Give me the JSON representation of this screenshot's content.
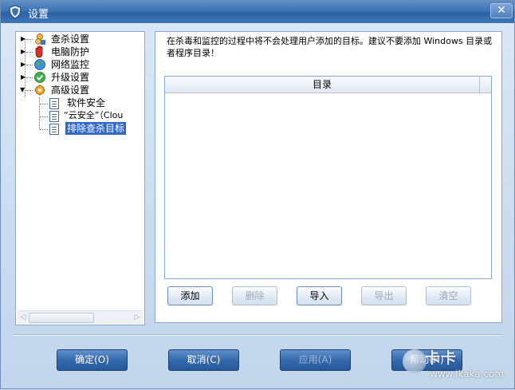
{
  "window": {
    "title": "设置",
    "close_glyph": "✕"
  },
  "tree": {
    "items": [
      {
        "label": "查杀设置",
        "icon": "scan-icon"
      },
      {
        "label": "电脑防护",
        "icon": "hand-shield-icon"
      },
      {
        "label": "网络监控",
        "icon": "network-globe-icon"
      },
      {
        "label": "升级设置",
        "icon": "update-check-icon"
      },
      {
        "label": "高级设置",
        "icon": "gear-icon"
      }
    ],
    "children": [
      {
        "label": "软件安全",
        "icon": "document-icon"
      },
      {
        "label": "“云安全”（Clou",
        "icon": "document-icon"
      },
      {
        "label": "排除查杀目标",
        "icon": "document-icon",
        "selected": true
      }
    ]
  },
  "content": {
    "description": "在杀毒和监控的过程中将不会处理用户添加的目标。建议不要添加 Windows 目录或者程序目录！",
    "list_header": "目录"
  },
  "actions": {
    "add": "添加",
    "delete": "删除",
    "import": "导入",
    "export": "导出",
    "clear": "清空"
  },
  "dialog": {
    "ok": "确定(O)",
    "cancel": "取消(C)",
    "apply": "应用(A)",
    "help": "帮助(H)"
  },
  "watermark": {
    "text": "卡卡",
    "url": "www.ikaka.com"
  },
  "colors": {
    "titlebar": "#3c73b3",
    "selection": "#3168c6",
    "dialog_button": "#3469ac"
  }
}
